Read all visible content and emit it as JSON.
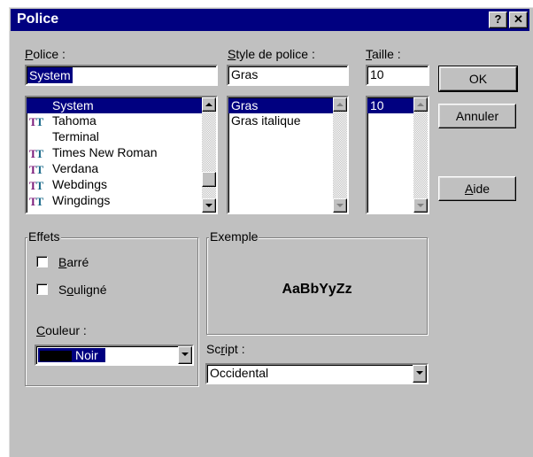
{
  "dialog": {
    "title": "Police",
    "help_glyph": "?",
    "close_glyph": "✕"
  },
  "font": {
    "label": "Police :",
    "value": "System",
    "items": [
      "System",
      "Tahoma",
      "Terminal",
      "Times New Roman",
      "Verdana",
      "Webdings",
      "Wingdings"
    ],
    "selected": "System"
  },
  "style": {
    "label": "Style de police :",
    "value": "Gras",
    "items": [
      "Gras",
      "Gras italique"
    ],
    "selected": "Gras"
  },
  "size": {
    "label": "Taille :",
    "value": "10",
    "items": [
      "10"
    ],
    "selected": "10"
  },
  "buttons": {
    "ok": "OK",
    "cancel": "Annuler",
    "help": "Aide"
  },
  "effects": {
    "title": "Effets",
    "strike_label": "Barré",
    "underline_label": "Souligné",
    "strike_checked": false,
    "underline_checked": false,
    "color_label": "Couleur :",
    "color_value": "Noir",
    "color_swatch": "#000000"
  },
  "sample": {
    "title": "Exemple",
    "text": "AaBbYyZz"
  },
  "script": {
    "label": "Script :",
    "value": "Occidental"
  },
  "icons": {
    "truetype": "truetype-font-icon"
  }
}
